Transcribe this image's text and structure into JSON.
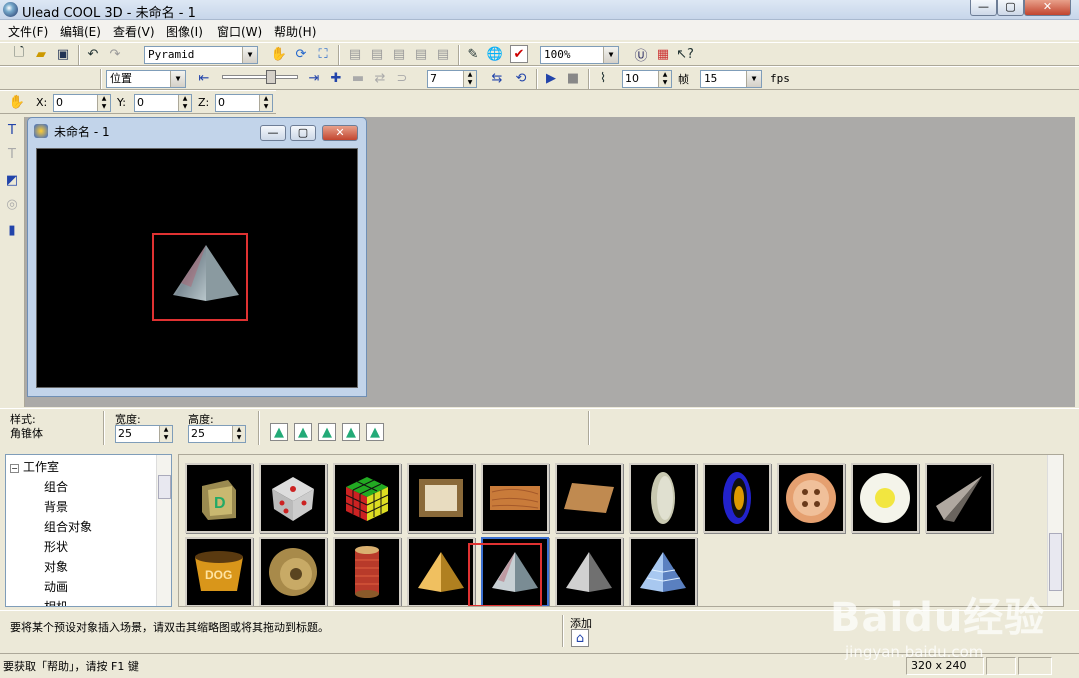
{
  "app": {
    "title": "Ulead COOL 3D - 未命名 - 1"
  },
  "window_controls": {
    "minimize": "—",
    "maximize": "▢",
    "close": "✕"
  },
  "menu": [
    "文件(F)",
    "编辑(E)",
    "查看(V)",
    "图像(I)",
    "窗口(W)",
    "帮助(H)"
  ],
  "toolbar1": {
    "object_select": "Pyramid",
    "zoom_select": "100%"
  },
  "toolbar2": {
    "attribute_select": "位置",
    "frame_value": "7",
    "frame_count": "10",
    "frame_unit": "帧",
    "fps_value": "15",
    "fps_unit": "fps"
  },
  "toolbar3": {
    "x_label": "X:",
    "x_value": "0",
    "y_label": "Y:",
    "y_value": "0",
    "z_label": "Z:",
    "z_value": "0"
  },
  "child_window": {
    "title": "未命名 - 1"
  },
  "properties": {
    "style_label": "样式:",
    "style_value": "角锥体",
    "width_label": "宽度:",
    "width_value": "25",
    "height_label": "高度:",
    "height_value": "25"
  },
  "tree": {
    "root": "工作室",
    "items": [
      "组合",
      "背景",
      "组合对象",
      "形状",
      "对象",
      "动画",
      "相机"
    ]
  },
  "thumbnails": [
    {
      "name": "block-d"
    },
    {
      "name": "dice"
    },
    {
      "name": "rubiks-cube"
    },
    {
      "name": "picture-frame"
    },
    {
      "name": "wood-plank"
    },
    {
      "name": "cork-board"
    },
    {
      "name": "coin"
    },
    {
      "name": "blue-disc"
    },
    {
      "name": "button"
    },
    {
      "name": "egg"
    },
    {
      "name": "cone"
    },
    {
      "name": "dog-bowl"
    },
    {
      "name": "lock"
    },
    {
      "name": "spool"
    },
    {
      "name": "gold-pyramid"
    },
    {
      "name": "marble-pyramid"
    },
    {
      "name": "stone-pyramid"
    },
    {
      "name": "glass-pyramid"
    }
  ],
  "hint": {
    "text": "要将某个预设对象插入场景，请双击其缩略图或将其拖动到标题。",
    "add_label": "添加"
  },
  "status": {
    "help_text": "要获取「帮助」，请按 F1 键",
    "size": "320 x 240"
  },
  "watermark": {
    "brand": "Baidu经验",
    "url": "jingyan.baidu.com"
  }
}
